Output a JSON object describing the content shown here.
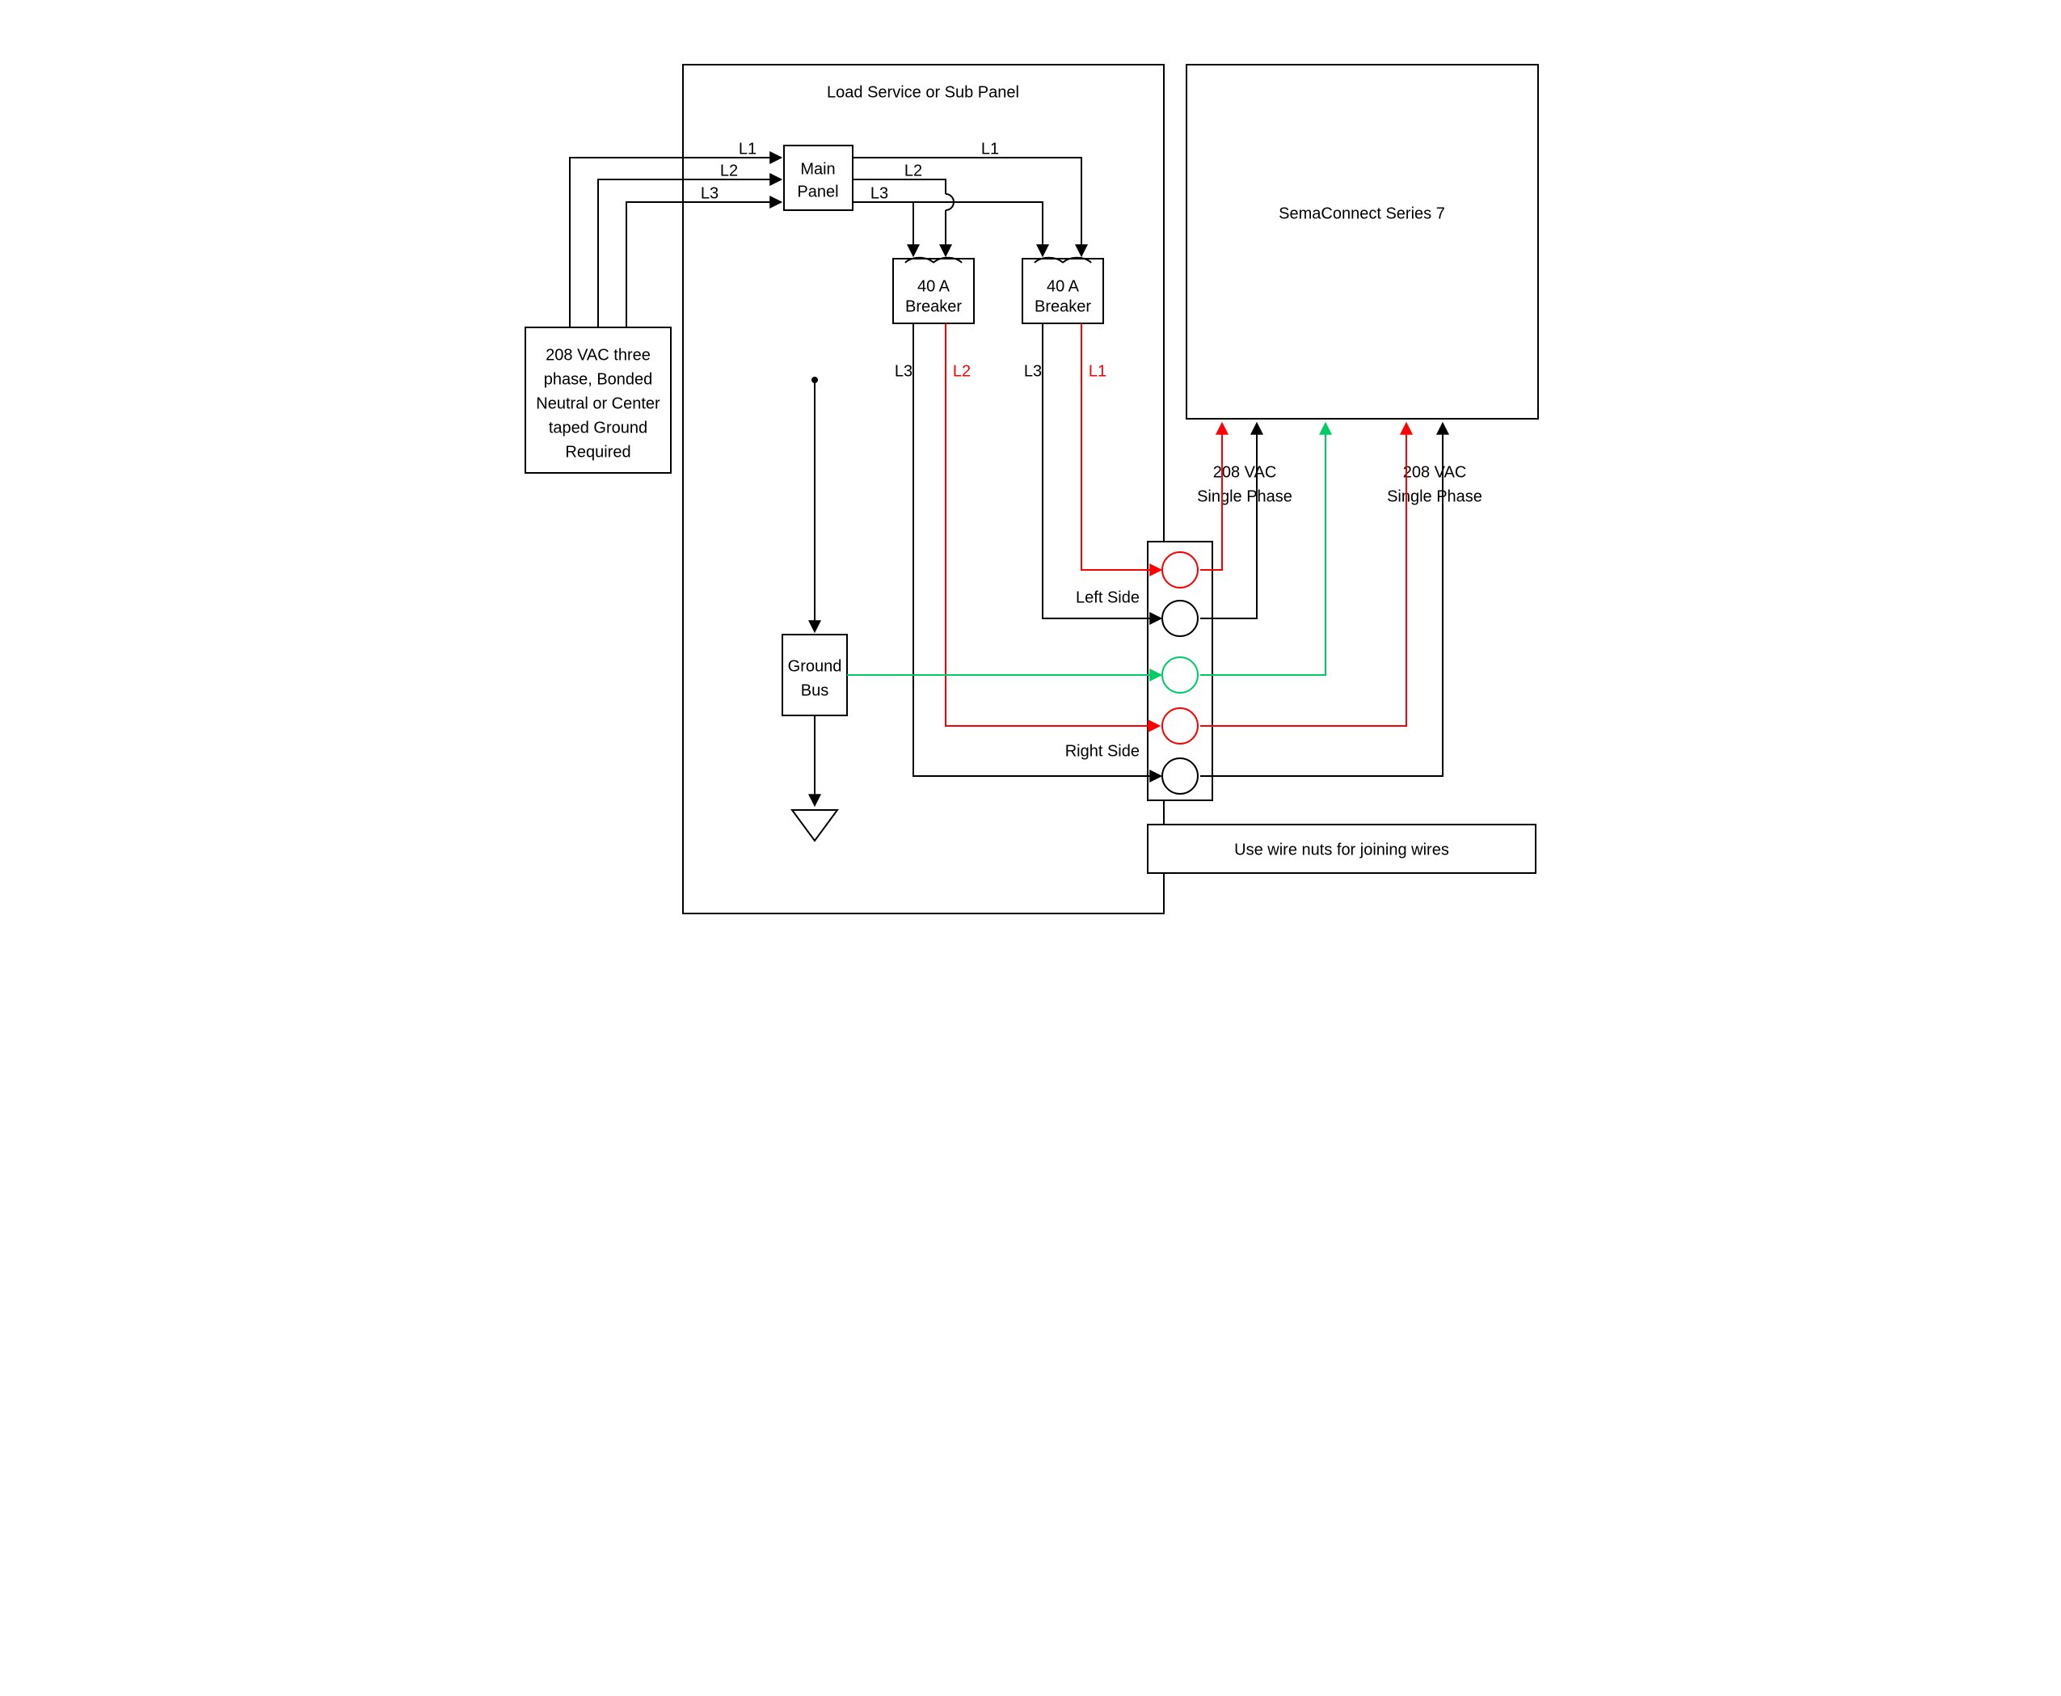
{
  "panel": {
    "title": "Load Service or Sub Panel",
    "main_panel_line1": "Main",
    "main_panel_line2": "Panel",
    "breaker1_line1": "40 A",
    "breaker1_line2": "Breaker",
    "breaker2_line1": "40 A",
    "breaker2_line2": "Breaker",
    "ground_bus_line1": "Ground",
    "ground_bus_line2": "Bus"
  },
  "source": {
    "l1": "208 VAC three",
    "l2": "phase, Bonded",
    "l3": "Neutral or Center",
    "l4": "taped Ground",
    "l5": "Required"
  },
  "device": {
    "title": "SemaConnect Series 7",
    "left_side": "Left Side",
    "right_side": "Right Side",
    "phase1_l1": "208 VAC",
    "phase1_l2": "Single Phase",
    "phase2_l1": "208 VAC",
    "phase2_l2": "Single Phase",
    "note": "Use wire nuts for joining wires"
  },
  "labels": {
    "L1": "L1",
    "L2": "L2",
    "L3": "L3"
  },
  "colors": {
    "red": "#ff0000",
    "green": "#00cc66",
    "black": "#000000"
  }
}
